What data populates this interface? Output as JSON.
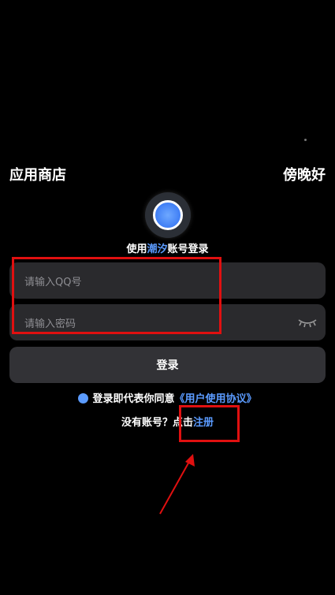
{
  "header": {
    "left_title": "应用商店",
    "right_greeting": "傍晚好"
  },
  "login": {
    "subtitle_prefix": "使用",
    "subtitle_brand": "潮汐",
    "subtitle_suffix": "账号登录",
    "qq_placeholder": "请输入QQ号",
    "password_placeholder": "请输入密码",
    "login_button": "登录",
    "agreement_prefix": "登录即代表你同意",
    "agreement_link": "《用户使用协议》",
    "register_prefix": "没有账号？点击",
    "register_link": "注册"
  },
  "colors": {
    "accent": "#5b9bff",
    "annotation": "#e01010",
    "field_bg": "#2a2a2d"
  },
  "icons": {
    "logo": "app-logo-icon",
    "eye": "eye-closed-icon",
    "check": "check-circle-icon"
  }
}
